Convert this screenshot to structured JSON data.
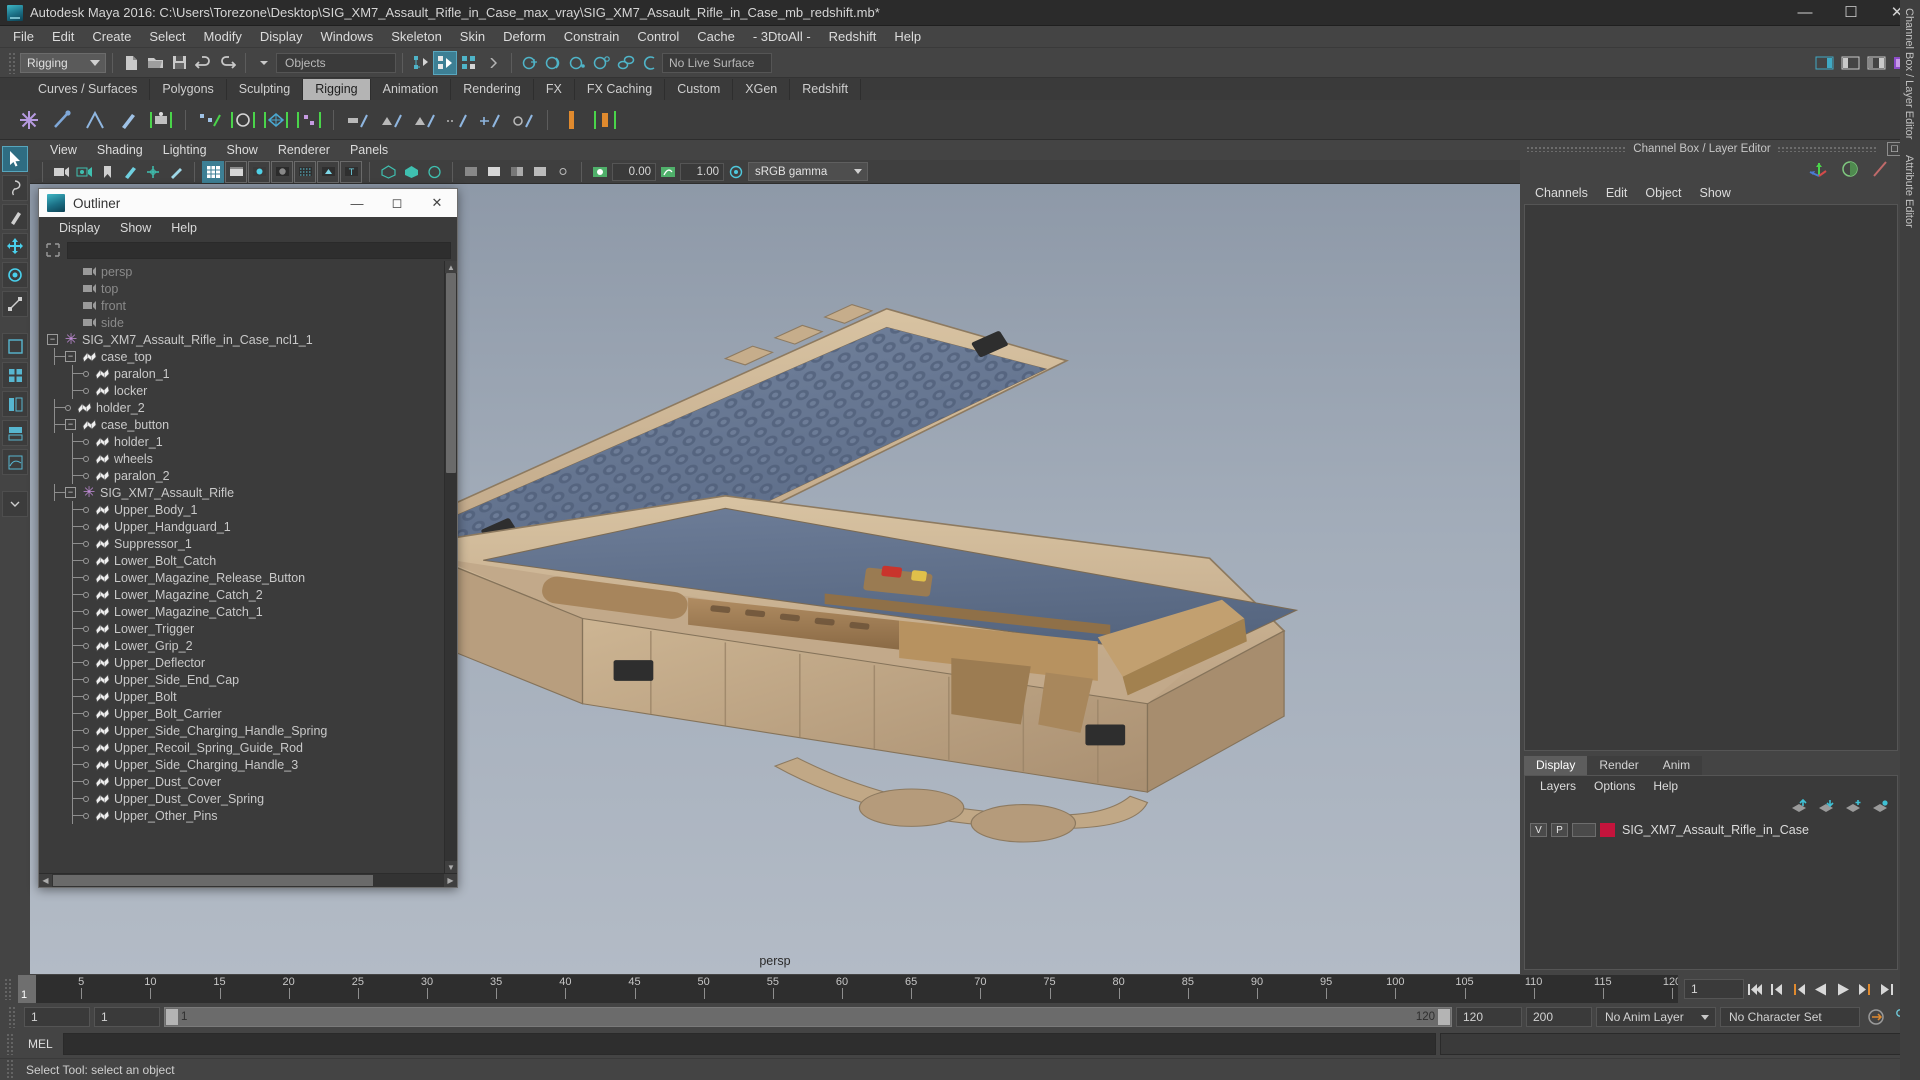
{
  "window": {
    "title": "Autodesk Maya 2016: C:\\Users\\Torezone\\Desktop\\SIG_XM7_Assault_Rifle_in_Case_max_vray\\SIG_XM7_Assault_Rifle_in_Case_mb_redshift.mb*",
    "minimize": "—",
    "maximize": "☐",
    "close": "✕"
  },
  "menubar": [
    "File",
    "Edit",
    "Create",
    "Select",
    "Modify",
    "Display",
    "Windows",
    "Skeleton",
    "Skin",
    "Deform",
    "Constrain",
    "Control",
    "Cache",
    "- 3DtoAll -",
    "Redshift",
    "Help"
  ],
  "statusline": {
    "mode": "Rigging",
    "objects_field": "Objects",
    "live_surface": "No Live Surface"
  },
  "shelf": {
    "tabs": [
      "Curves / Surfaces",
      "Polygons",
      "Sculpting",
      "Rigging",
      "Animation",
      "Rendering",
      "FX",
      "FX Caching",
      "Custom",
      "XGen",
      "Redshift"
    ],
    "active": "Rigging"
  },
  "viewport": {
    "menus": [
      "View",
      "Shading",
      "Lighting",
      "Show",
      "Renderer",
      "Panels"
    ],
    "exposure": "0.00",
    "gamma": "1.00",
    "color_profile": "sRGB gamma",
    "camera_label": "persp"
  },
  "outliner": {
    "title": "Outliner",
    "menus": [
      "Display",
      "Show",
      "Help"
    ],
    "search_value": "",
    "items": [
      {
        "label": "persp",
        "icon": "camera-icon",
        "depth": 1,
        "node": "none",
        "dim": true
      },
      {
        "label": "top",
        "icon": "camera-icon",
        "depth": 1,
        "node": "none",
        "dim": true
      },
      {
        "label": "front",
        "icon": "camera-icon",
        "depth": 1,
        "node": "none",
        "dim": true
      },
      {
        "label": "side",
        "icon": "camera-icon",
        "depth": 1,
        "node": "none",
        "dim": true
      },
      {
        "label": "SIG_XM7_Assault_Rifle_in_Case_ncl1_1",
        "icon": "star-icon",
        "depth": 0,
        "node": "minus",
        "dim": false
      },
      {
        "label": "case_top",
        "icon": "mesh-icon",
        "depth": 1,
        "node": "minus",
        "dim": false
      },
      {
        "label": "paralon_1",
        "icon": "mesh-icon",
        "depth": 2,
        "node": "leaf",
        "dim": false
      },
      {
        "label": "locker",
        "icon": "mesh-icon",
        "depth": 2,
        "node": "leaf",
        "dim": false
      },
      {
        "label": "holder_2",
        "icon": "mesh-icon",
        "depth": 1,
        "node": "leaf",
        "dim": false
      },
      {
        "label": "case_button",
        "icon": "mesh-icon",
        "depth": 1,
        "node": "minus",
        "dim": false
      },
      {
        "label": "holder_1",
        "icon": "mesh-icon",
        "depth": 2,
        "node": "leaf",
        "dim": false
      },
      {
        "label": "wheels",
        "icon": "mesh-icon",
        "depth": 2,
        "node": "leaf",
        "dim": false
      },
      {
        "label": "paralon_2",
        "icon": "mesh-icon",
        "depth": 2,
        "node": "leaf",
        "dim": false
      },
      {
        "label": "SIG_XM7_Assault_Rifle",
        "icon": "star-icon",
        "depth": 1,
        "node": "minus",
        "dim": false
      },
      {
        "label": "Upper_Body_1",
        "icon": "mesh-icon",
        "depth": 2,
        "node": "leaf",
        "dim": false
      },
      {
        "label": "Upper_Handguard_1",
        "icon": "mesh-icon",
        "depth": 2,
        "node": "leaf",
        "dim": false
      },
      {
        "label": "Suppressor_1",
        "icon": "mesh-icon",
        "depth": 2,
        "node": "leaf",
        "dim": false
      },
      {
        "label": "Lower_Bolt_Catch",
        "icon": "mesh-icon",
        "depth": 2,
        "node": "leaf",
        "dim": false
      },
      {
        "label": "Lower_Magazine_Release_Button",
        "icon": "mesh-icon",
        "depth": 2,
        "node": "leaf",
        "dim": false
      },
      {
        "label": "Lower_Magazine_Catch_2",
        "icon": "mesh-icon",
        "depth": 2,
        "node": "leaf",
        "dim": false
      },
      {
        "label": "Lower_Magazine_Catch_1",
        "icon": "mesh-icon",
        "depth": 2,
        "node": "leaf",
        "dim": false
      },
      {
        "label": "Lower_Trigger",
        "icon": "mesh-icon",
        "depth": 2,
        "node": "leaf",
        "dim": false
      },
      {
        "label": "Lower_Grip_2",
        "icon": "mesh-icon",
        "depth": 2,
        "node": "leaf",
        "dim": false
      },
      {
        "label": "Upper_Deflector",
        "icon": "mesh-icon",
        "depth": 2,
        "node": "leaf",
        "dim": false
      },
      {
        "label": "Upper_Side_End_Cap",
        "icon": "mesh-icon",
        "depth": 2,
        "node": "leaf",
        "dim": false
      },
      {
        "label": "Upper_Bolt",
        "icon": "mesh-icon",
        "depth": 2,
        "node": "leaf",
        "dim": false
      },
      {
        "label": "Upper_Bolt_Carrier",
        "icon": "mesh-icon",
        "depth": 2,
        "node": "leaf",
        "dim": false
      },
      {
        "label": "Upper_Side_Charging_Handle_Spring",
        "icon": "mesh-icon",
        "depth": 2,
        "node": "leaf",
        "dim": false
      },
      {
        "label": "Upper_Recoil_Spring_Guide_Rod",
        "icon": "mesh-icon",
        "depth": 2,
        "node": "leaf",
        "dim": false
      },
      {
        "label": "Upper_Side_Charging_Handle_3",
        "icon": "mesh-icon",
        "depth": 2,
        "node": "leaf",
        "dim": false
      },
      {
        "label": "Upper_Dust_Cover",
        "icon": "mesh-icon",
        "depth": 2,
        "node": "leaf",
        "dim": false
      },
      {
        "label": "Upper_Dust_Cover_Spring",
        "icon": "mesh-icon",
        "depth": 2,
        "node": "leaf",
        "dim": false
      },
      {
        "label": "Upper_Other_Pins",
        "icon": "mesh-icon",
        "depth": 2,
        "node": "leaf",
        "dim": false
      }
    ]
  },
  "channelbox": {
    "panel_title": "Channel Box / Layer Editor",
    "menus": [
      "Channels",
      "Edit",
      "Object",
      "Show"
    ],
    "vertical_tabs": [
      "Channel Box / Layer Editor",
      "Attribute Editor"
    ]
  },
  "layereditor": {
    "tabs": [
      "Display",
      "Render",
      "Anim"
    ],
    "active_tab": "Display",
    "menus": [
      "Layers",
      "Options",
      "Help"
    ],
    "layers": [
      {
        "visibility": "V",
        "playback": "P",
        "color": "#c4143c",
        "name": "SIG_XM7_Assault_Rifle_in_Case"
      }
    ]
  },
  "timeline": {
    "ticks": [
      5,
      10,
      15,
      20,
      25,
      30,
      35,
      40,
      45,
      50,
      55,
      60,
      65,
      70,
      75,
      80,
      85,
      90,
      95,
      100,
      105,
      110,
      115,
      120
    ],
    "start": 1,
    "end": 120,
    "current_frame": "1",
    "current_frame_field": "1"
  },
  "rangebar": {
    "anim_start": "1",
    "range_start": "1",
    "slider_left_value": "1",
    "slider_right_value": "120",
    "range_end": "120",
    "anim_end": "200",
    "anim_layer": "No Anim Layer",
    "character_set": "No Character Set"
  },
  "melbar": {
    "label": "MEL",
    "input_value": ""
  },
  "statusbar": {
    "message": "Select Tool: select an object"
  },
  "colors": {
    "accent_teal": "#3d7f94",
    "layer_red": "#c4143c",
    "case_tan": "#c9b190",
    "foam_blue": "#6a7a96",
    "orange_marker": "#e08a2e"
  }
}
